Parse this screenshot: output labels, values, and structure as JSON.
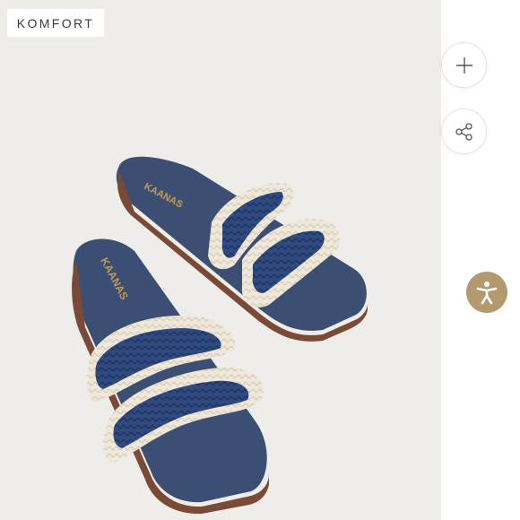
{
  "brand_badge": {
    "label": "KOMFORT"
  },
  "product_photo": {
    "sandal_imprint": "KAANAS"
  },
  "actions": {
    "add_icon": "plus-icon",
    "share_icon": "share-icon",
    "accessibility_icon": "accessibility-icon"
  },
  "colors": {
    "background": "#efedea",
    "sandal_navy": "#33496c",
    "crochet_cream": "#efe8da",
    "accessibility_accent": "#b29a6e"
  }
}
